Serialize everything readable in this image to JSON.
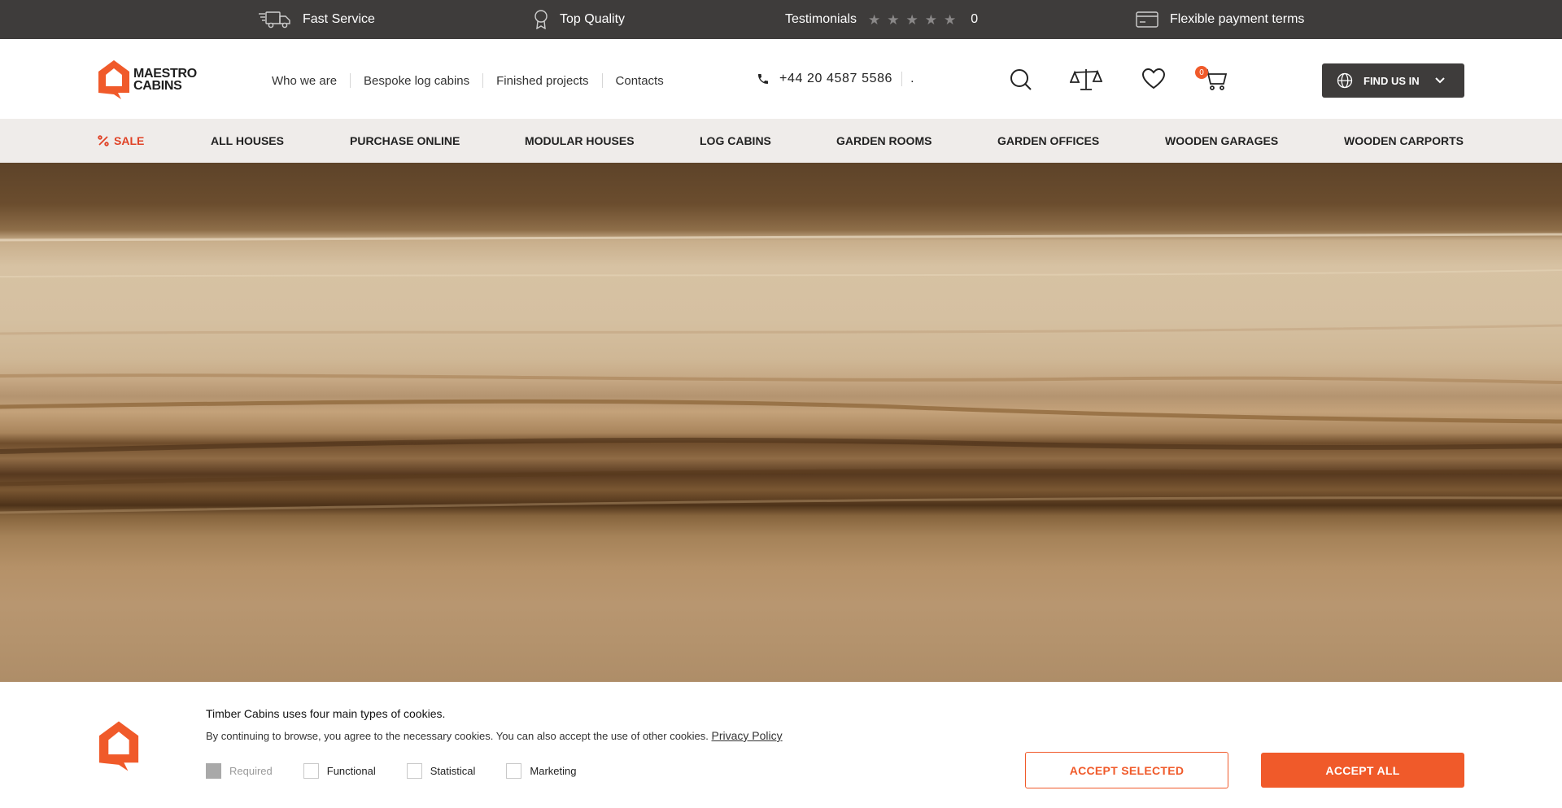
{
  "topbar": {
    "fast_service": "Fast Service",
    "top_quality": "Top Quality",
    "testimonials": "Testimonials",
    "rating": "0",
    "payment": "Flexible payment terms"
  },
  "header": {
    "logo_line1": "MAESTRO",
    "logo_line2": "CABINS",
    "links": [
      "Who we are",
      "Bespoke log cabins",
      "Finished projects",
      "Contacts"
    ],
    "phone": "+44 20 4587 5586",
    "phone_extra": ".",
    "cart_count": "0",
    "find_us": "FIND US IN"
  },
  "nav": {
    "sale": "SALE",
    "items": [
      "ALL HOUSES",
      "PURCHASE ONLINE",
      "MODULAR HOUSES",
      "LOG CABINS",
      "GARDEN ROOMS",
      "GARDEN OFFICES",
      "WOODEN GARAGES",
      "WOODEN CARPORTS"
    ]
  },
  "cookie": {
    "title": "Timber Cabins uses four main types of cookies.",
    "text": "By continuing to browse, you agree to the necessary cookies. You can also accept the use of other cookies.",
    "privacy": "Privacy Policy",
    "options": [
      "Required",
      "Functional",
      "Statistical",
      "Marketing"
    ],
    "accept_selected": "ACCEPT SELECTED",
    "accept_all": "ACCEPT ALL"
  },
  "colors": {
    "accent": "#f05a2a",
    "dark": "#3e3c3b",
    "nav_bg": "#efecea",
    "sale": "#e04226"
  }
}
